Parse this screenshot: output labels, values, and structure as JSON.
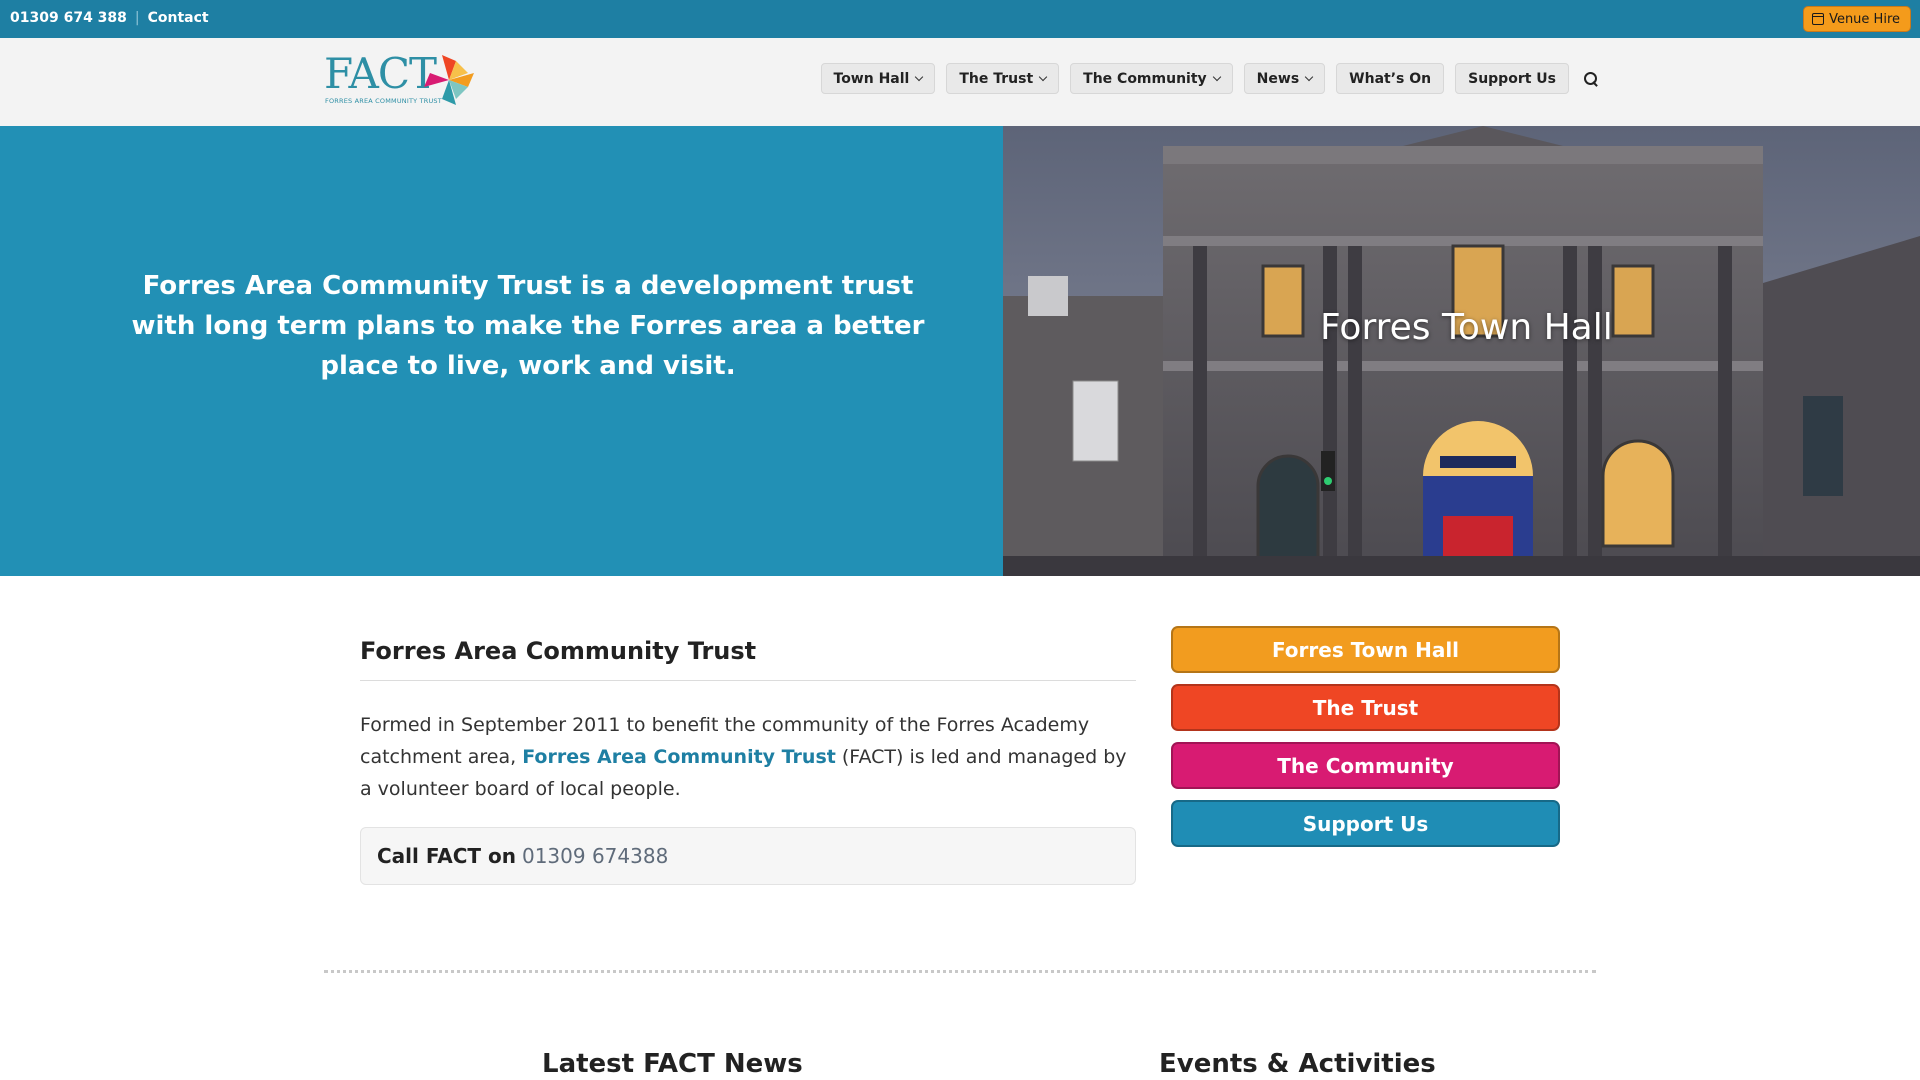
{
  "topbar": {
    "phone": "01309 674 388",
    "separator": "|",
    "contact": "Contact",
    "venue_hire": "Venue Hire",
    "color": "#1e7fa3"
  },
  "logo": {
    "text": "FACT",
    "subtitle": "FORRES AREA COMMUNITY TRUST"
  },
  "nav": {
    "items": [
      {
        "label": "Town Hall",
        "has_dropdown": true
      },
      {
        "label": "The Trust",
        "has_dropdown": true
      },
      {
        "label": "The Community",
        "has_dropdown": true
      },
      {
        "label": "News",
        "has_dropdown": true
      },
      {
        "label": "What’s On",
        "has_dropdown": false
      },
      {
        "label": "Support Us",
        "has_dropdown": false
      }
    ],
    "search_icon": "search-icon"
  },
  "hero": {
    "text": "Forres Area Community Trust is a development trust with long term plans to make the Forres area a better place to live, work and visit.",
    "caption": "Forres Town Hall",
    "bg_color": "#2290b5"
  },
  "main": {
    "title": "Forres Area Community Trust",
    "para_before": "Formed in September 2011 to benefit the community of the Forres Academy catchment area, ",
    "para_link": "Forres Area Community Trust",
    "para_after": " (FACT) is led and managed by a volunteer board of local people.",
    "call_label": "Call FACT on",
    "call_number": "01309 674388"
  },
  "side_buttons": [
    {
      "label": "Forres Town Hall",
      "color": "#f29c1f"
    },
    {
      "label": "The Trust",
      "color": "#ef4624"
    },
    {
      "label": "The Community",
      "color": "#d81b72"
    },
    {
      "label": "Support Us",
      "color": "#1f8db5"
    }
  ],
  "sections": {
    "news_title": "Latest FACT News",
    "events_title": "Events & Activities"
  }
}
